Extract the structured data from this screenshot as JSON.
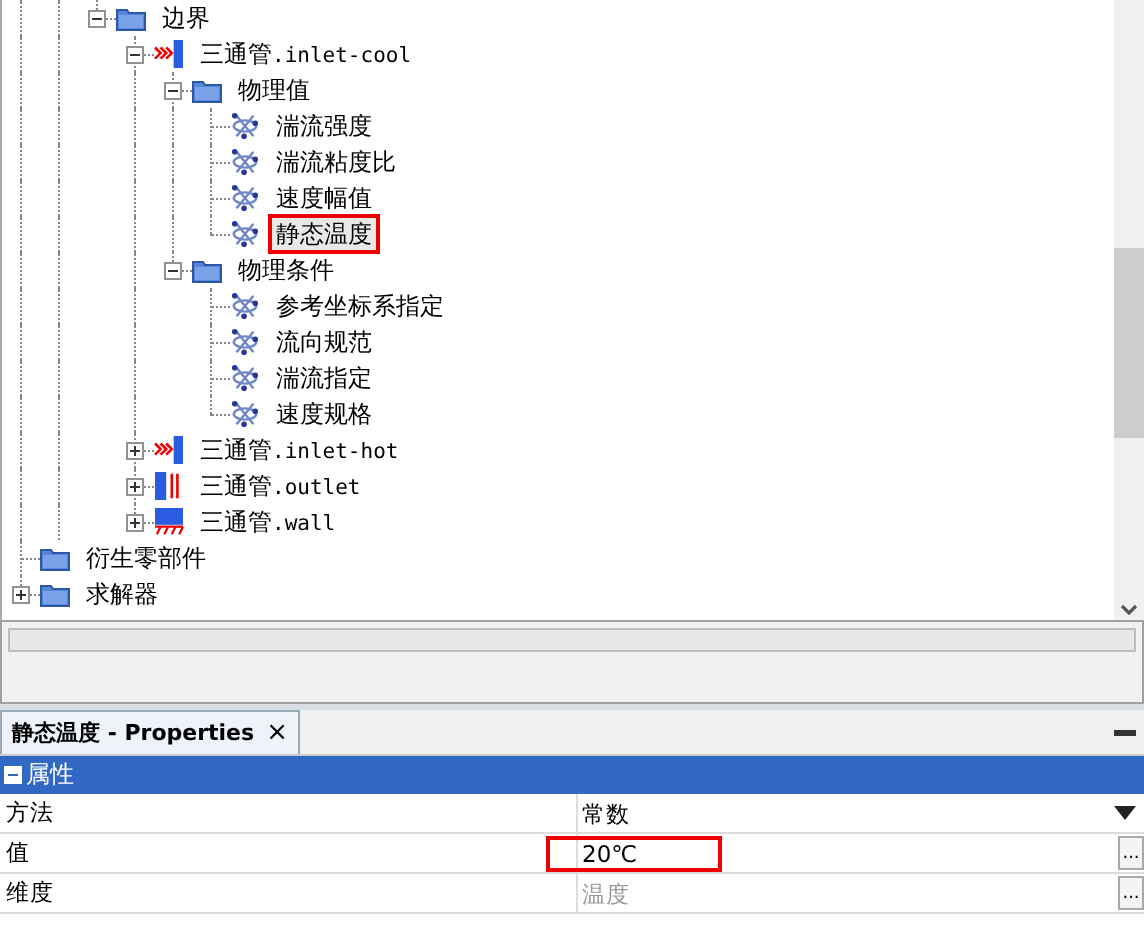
{
  "tree": {
    "items": [
      {
        "label": "边界",
        "kind": "folder",
        "expanded": true,
        "children": [
          {
            "label": "三通管",
            "suffix": ".inlet-cool",
            "kind": "inlet",
            "expanded": true,
            "children": [
              {
                "label": "物理值",
                "kind": "folder",
                "expanded": true,
                "children": [
                  {
                    "label": "湍流强度",
                    "kind": "field",
                    "selected": false,
                    "highlighted": false
                  },
                  {
                    "label": "湍流粘度比",
                    "kind": "field",
                    "selected": false,
                    "highlighted": false
                  },
                  {
                    "label": "速度幅值",
                    "kind": "field",
                    "selected": false,
                    "highlighted": false
                  },
                  {
                    "label": "静态温度",
                    "kind": "field",
                    "selected": true,
                    "highlighted": true
                  }
                ]
              },
              {
                "label": "物理条件",
                "kind": "folder",
                "expanded": true,
                "children": [
                  {
                    "label": "参考坐标系指定",
                    "kind": "field",
                    "selected": false,
                    "highlighted": false
                  },
                  {
                    "label": "流向规范",
                    "kind": "field",
                    "selected": false,
                    "highlighted": false
                  },
                  {
                    "label": "湍流指定",
                    "kind": "field",
                    "selected": false,
                    "highlighted": false
                  },
                  {
                    "label": "速度规格",
                    "kind": "field",
                    "selected": false,
                    "highlighted": false
                  }
                ]
              }
            ]
          },
          {
            "label": "三通管",
            "suffix": ".inlet-hot",
            "kind": "inlet",
            "expanded": false,
            "expandable": true
          },
          {
            "label": "三通管",
            "suffix": ".outlet",
            "kind": "outlet",
            "expanded": false,
            "expandable": true
          },
          {
            "label": "三通管",
            "suffix": ".wall",
            "kind": "wall",
            "expanded": false,
            "expandable": true
          }
        ]
      },
      {
        "label": "衍生零部件",
        "kind": "folder"
      },
      {
        "label": "求解器",
        "kind": "folder",
        "expanded": false,
        "expandable": true
      }
    ]
  },
  "progress": {
    "level": 0
  },
  "properties": {
    "tab": {
      "title": "静态温度 - Properties",
      "close": "×"
    },
    "section": {
      "title": "属性",
      "expanded": true
    },
    "rows": [
      {
        "name": "方法",
        "value": "常数",
        "kind": "dropdown",
        "disabled": false,
        "highlighted": false
      },
      {
        "name": "值",
        "value": "20℃",
        "kind": "ellipsis",
        "disabled": false,
        "highlighted": true,
        "button": "..."
      },
      {
        "name": "维度",
        "value": "温度",
        "kind": "ellipsis",
        "disabled": true,
        "highlighted": false,
        "button": "..."
      }
    ]
  }
}
